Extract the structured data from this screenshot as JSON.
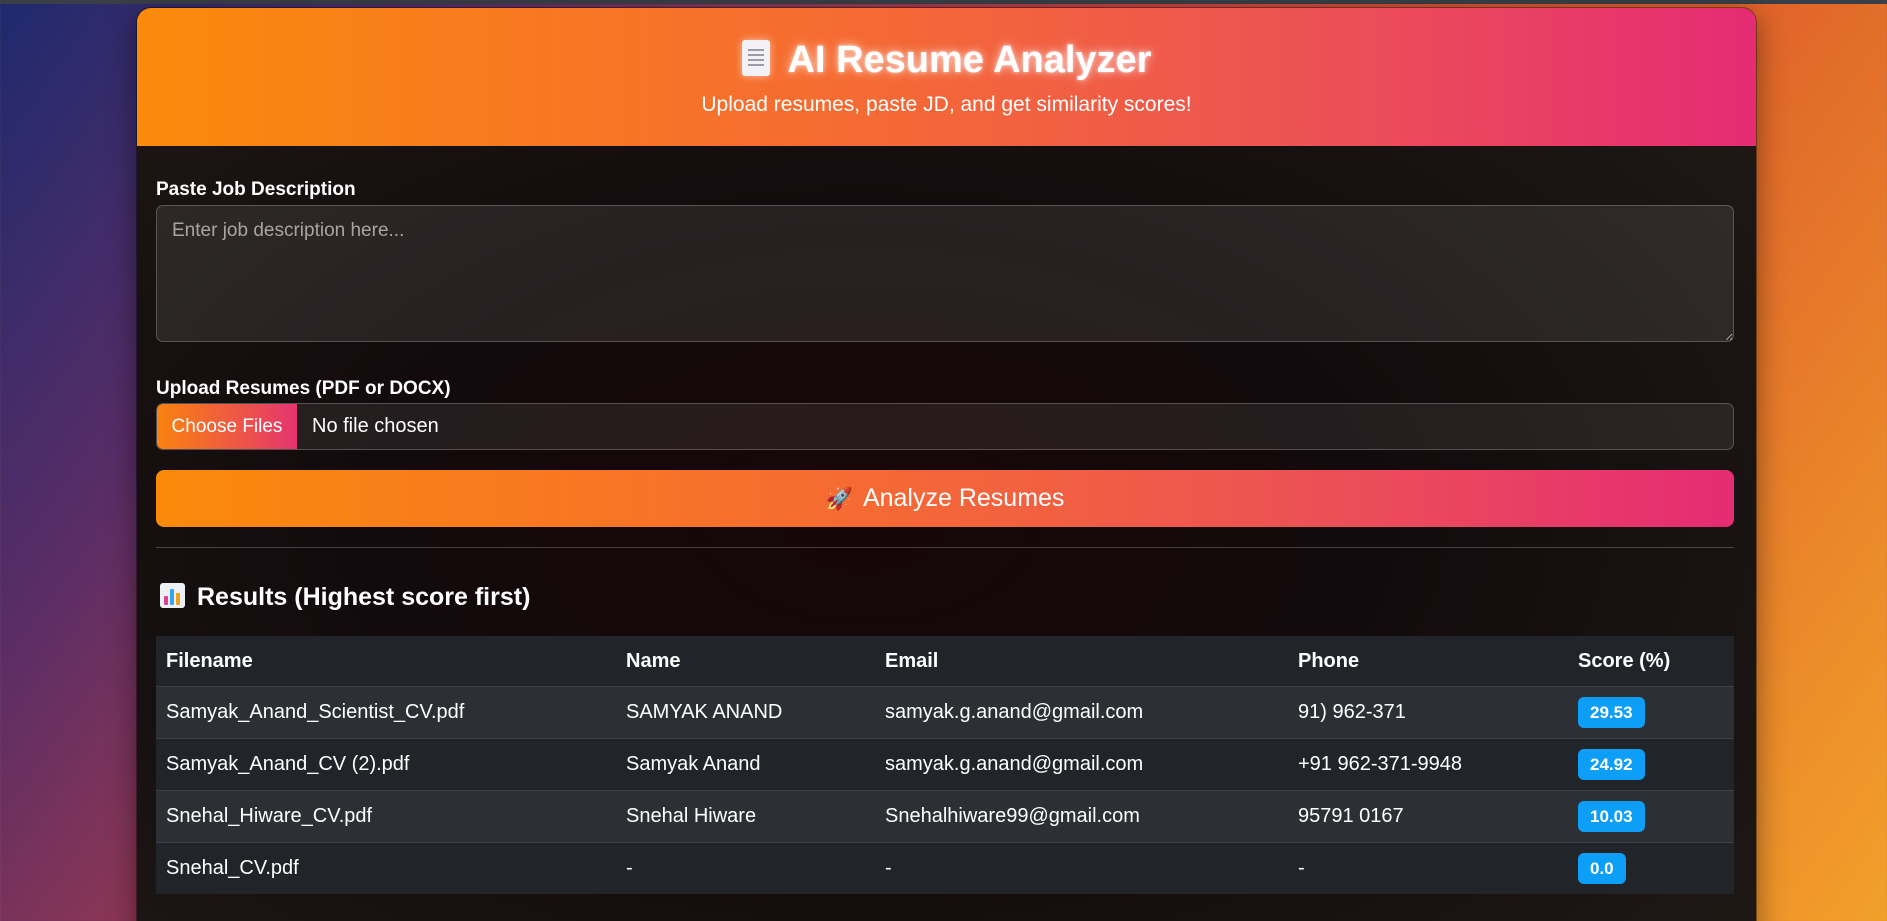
{
  "header": {
    "title": "AI Resume Analyzer",
    "title_icon": "document-icon",
    "subtitle": "Upload resumes, paste JD, and get similarity scores!"
  },
  "job_description": {
    "label": "Paste Job Description",
    "placeholder": "Enter job description here...",
    "value": ""
  },
  "upload": {
    "label": "Upload Resumes (PDF or DOCX)",
    "button_label": "Choose Files",
    "status": "No file chosen"
  },
  "analyze": {
    "label": "Analyze Resumes",
    "icon": "rocket-icon"
  },
  "results": {
    "title": "Results (Highest score first)",
    "icon": "bar-chart-icon",
    "columns": [
      "Filename",
      "Name",
      "Email",
      "Phone",
      "Score (%)"
    ],
    "rows": [
      {
        "filename": "Samyak_Anand_Scientist_CV.pdf",
        "name": "SAMYAK ANAND",
        "email": "samyak.g.anand@gmail.com",
        "phone": "91) 962-371",
        "score": "29.53"
      },
      {
        "filename": "Samyak_Anand_CV (2).pdf",
        "name": "Samyak Anand",
        "email": "samyak.g.anand@gmail.com",
        "phone": "+91 962-371-9948",
        "score": "24.92"
      },
      {
        "filename": "Snehal_Hiware_CV.pdf",
        "name": "Snehal Hiware",
        "email": "Snehalhiware99@gmail.com",
        "phone": "95791 0167",
        "score": "10.03"
      },
      {
        "filename": "Snehal_CV.pdf",
        "name": "-",
        "email": "-",
        "phone": "-",
        "score": "0.0"
      }
    ]
  },
  "colors": {
    "header_gradient_start": "#fb8a0b",
    "header_gradient_end": "#e52b74",
    "score_badge": "#0d9ff8",
    "table_bg": "#212529"
  }
}
